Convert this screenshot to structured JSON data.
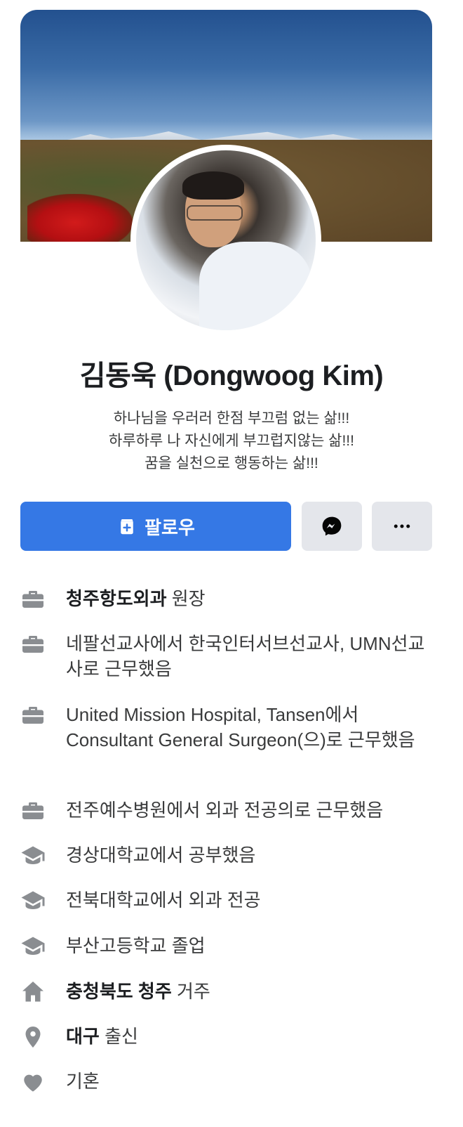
{
  "profile": {
    "name": "김동욱 (Dongwoog Kim)",
    "bio": [
      "하나님을 우러러 한점 부끄럼 없는 삶!!!",
      "하루하루 나 자신에게 부끄럽지않는 삶!!!",
      "꿈을 실천으로 행동하는 삶!!!"
    ]
  },
  "actions": {
    "follow_label": "팔로우",
    "messenger_icon": "messenger-icon",
    "more_icon": "more-icon"
  },
  "colors": {
    "primary": "#3578e5",
    "secondary_button": "#e4e6eb",
    "icon": "#8a8d91"
  },
  "info": [
    {
      "icon": "briefcase-icon",
      "bold": "청주항도외과",
      "text": " 원장"
    },
    {
      "icon": "briefcase-icon",
      "bold": "",
      "text": "네팔선교사에서 한국인터서브선교사, UMN선교사로 근무했음"
    },
    {
      "icon": "briefcase-icon",
      "bold": "",
      "text": "United Mission Hospital, Tansen에서 Consultant General Surgeon(으)로 근무했음"
    },
    {
      "icon": "briefcase-icon",
      "bold": "",
      "text": "전주예수병원에서 외과 전공의로 근무했음"
    },
    {
      "icon": "graduation-cap-icon",
      "bold": "",
      "text": "경상대학교에서 공부했음"
    },
    {
      "icon": "graduation-cap-icon",
      "bold": "",
      "text": "전북대학교에서 외과 전공"
    },
    {
      "icon": "graduation-cap-icon",
      "bold": "",
      "text": "부산고등학교 졸업"
    },
    {
      "icon": "home-icon",
      "bold": "충청북도 청주",
      "text": " 거주"
    },
    {
      "icon": "location-pin-icon",
      "bold": "대구",
      "text": " 출신"
    },
    {
      "icon": "heart-icon",
      "bold": "",
      "text": "기혼"
    }
  ]
}
